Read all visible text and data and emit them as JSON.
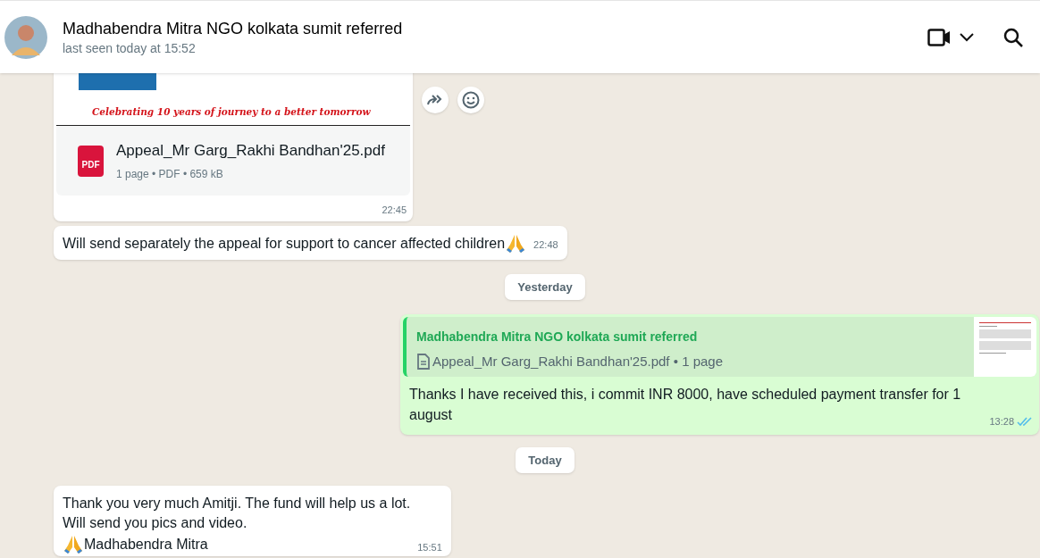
{
  "header": {
    "contact_name": "Madhabendra Mitra NGO kolkata sumit referred",
    "status": "last seen today at 15:52"
  },
  "messages": [
    {
      "kind": "document",
      "outgoing": false,
      "caption": "Celebrating 10 years of journey to a better tomorrow",
      "file_name": "Appeal_Mr Garg_Rakhi Bandhan'25.pdf",
      "file_meta": "1 page • PDF • 659 kB",
      "file_badge": "PDF",
      "time": "22:45",
      "hover_actions": true
    },
    {
      "kind": "text",
      "outgoing": false,
      "lines": [
        {
          "text": "Will send separately the appeal for support to cancer affected children",
          "emoji_after": true
        }
      ],
      "time": "22:48"
    },
    {
      "kind": "date",
      "label": "Yesterday"
    },
    {
      "kind": "reply",
      "outgoing": true,
      "quote_author": "Madhabendra Mitra NGO kolkata sumit referred",
      "quote_text": "Appeal_Mr Garg_Rakhi Bandhan'25.pdf • 1 page",
      "lines": [
        {
          "text": "Thanks I have received this, i commit INR 8000, have scheduled payment transfer for 1 august"
        }
      ],
      "time": "13:28",
      "read": true
    },
    {
      "kind": "date",
      "label": "Today"
    },
    {
      "kind": "text",
      "outgoing": false,
      "lines": [
        {
          "text": "Thank you very much Amitji. The fund will help us a lot."
        },
        {
          "text": "Will send you pics and video."
        },
        {
          "text": "Madhabendra Mitra",
          "emoji_before": true
        }
      ],
      "time": "15:51"
    }
  ]
}
